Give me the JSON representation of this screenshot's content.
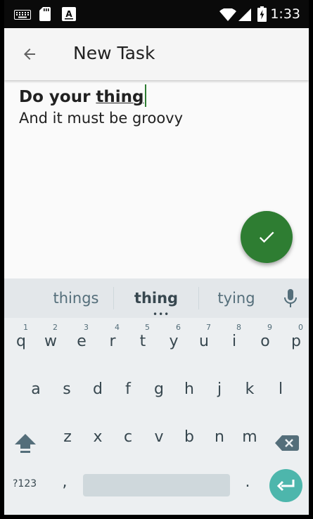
{
  "status_bar": {
    "time": "1:33",
    "icons": [
      "keyboard-icon",
      "sd-card-icon",
      "text-icon",
      "wifi-icon",
      "signal-icon",
      "battery-charging-icon"
    ]
  },
  "app_bar": {
    "title": "New Task",
    "back_icon": "arrow-back-icon"
  },
  "task": {
    "title_prefix": "Do your ",
    "title_composing": "thing",
    "description": "And it must be groovy"
  },
  "fab": {
    "icon": "check-icon",
    "color": "#2e7d32"
  },
  "keyboard": {
    "suggestions": [
      "things",
      "thing",
      "tying"
    ],
    "row1": [
      {
        "label": "q",
        "hint": "1"
      },
      {
        "label": "w",
        "hint": "2"
      },
      {
        "label": "e",
        "hint": "3"
      },
      {
        "label": "r",
        "hint": "4"
      },
      {
        "label": "t",
        "hint": "5"
      },
      {
        "label": "y",
        "hint": "6"
      },
      {
        "label": "u",
        "hint": "7"
      },
      {
        "label": "i",
        "hint": "8"
      },
      {
        "label": "o",
        "hint": "9"
      },
      {
        "label": "p",
        "hint": "0"
      }
    ],
    "row2": [
      "a",
      "s",
      "d",
      "f",
      "g",
      "h",
      "j",
      "k",
      "l"
    ],
    "row3": [
      "z",
      "x",
      "c",
      "v",
      "b",
      "n",
      "m"
    ],
    "symbols_label": "?123",
    "comma": ",",
    "period": ".",
    "enter_color": "#4db6ac"
  }
}
